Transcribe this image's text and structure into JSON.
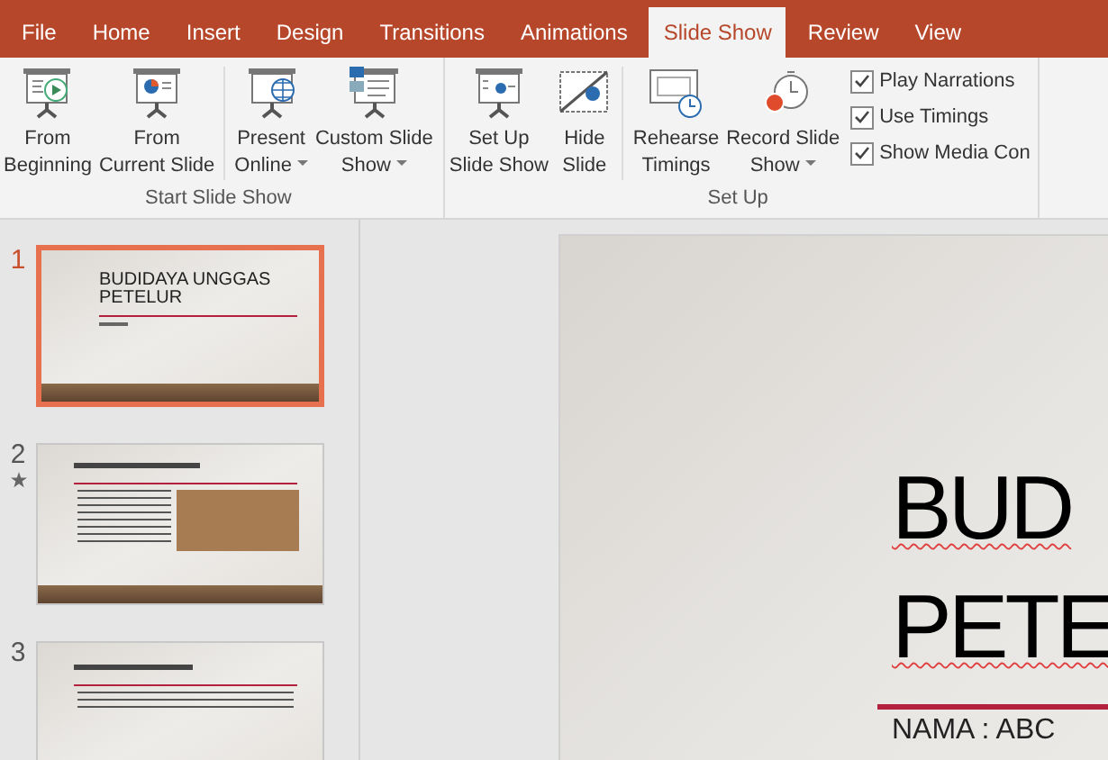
{
  "tabs": [
    {
      "label": "File",
      "selected": false
    },
    {
      "label": "Home",
      "selected": false
    },
    {
      "label": "Insert",
      "selected": false
    },
    {
      "label": "Design",
      "selected": false
    },
    {
      "label": "Transitions",
      "selected": false
    },
    {
      "label": "Animations",
      "selected": false
    },
    {
      "label": "Slide Show",
      "selected": true
    },
    {
      "label": "Review",
      "selected": false
    },
    {
      "label": "View",
      "selected": false
    }
  ],
  "ribbon": {
    "groups": [
      {
        "label": "Start Slide Show",
        "buttons": [
          {
            "kind": "play",
            "lines": [
              "From",
              "Beginning"
            ],
            "dropdown": false
          },
          {
            "kind": "chart",
            "lines": [
              "From",
              "Current Slide"
            ],
            "dropdown": false,
            "separator_after": true
          },
          {
            "kind": "globe",
            "lines": [
              "Present",
              "Online"
            ],
            "dropdown": true
          },
          {
            "kind": "custom",
            "lines": [
              "Custom Slide",
              "Show"
            ],
            "dropdown": true
          }
        ]
      },
      {
        "label": "Set Up",
        "buttons": [
          {
            "kind": "setup",
            "lines": [
              "Set Up",
              "Slide Show"
            ],
            "dropdown": false
          },
          {
            "kind": "hide",
            "lines": [
              "Hide",
              "Slide"
            ],
            "dropdown": false,
            "separator_after": true
          },
          {
            "kind": "rehearse",
            "lines": [
              "Rehearse",
              "Timings"
            ],
            "dropdown": false
          },
          {
            "kind": "record",
            "lines": [
              "Record Slide",
              "Show"
            ],
            "dropdown": true
          }
        ],
        "checkboxes": [
          {
            "label": "Play Narrations",
            "checked": true
          },
          {
            "label": "Use Timings",
            "checked": true
          },
          {
            "label": "Show Media Con",
            "checked": true
          }
        ]
      }
    ]
  },
  "thumbnails": [
    {
      "number": "1",
      "selected": true,
      "kind": "title",
      "title": "BUDIDAYA UNGGAS PETELUR",
      "animated": false
    },
    {
      "number": "2",
      "selected": false,
      "kind": "content-photo",
      "animated": true
    },
    {
      "number": "3",
      "selected": false,
      "kind": "content",
      "animated": false
    }
  ],
  "slide": {
    "title_lines": [
      "BUD",
      "PETE"
    ],
    "subtitle": "NAMA : ABC"
  }
}
